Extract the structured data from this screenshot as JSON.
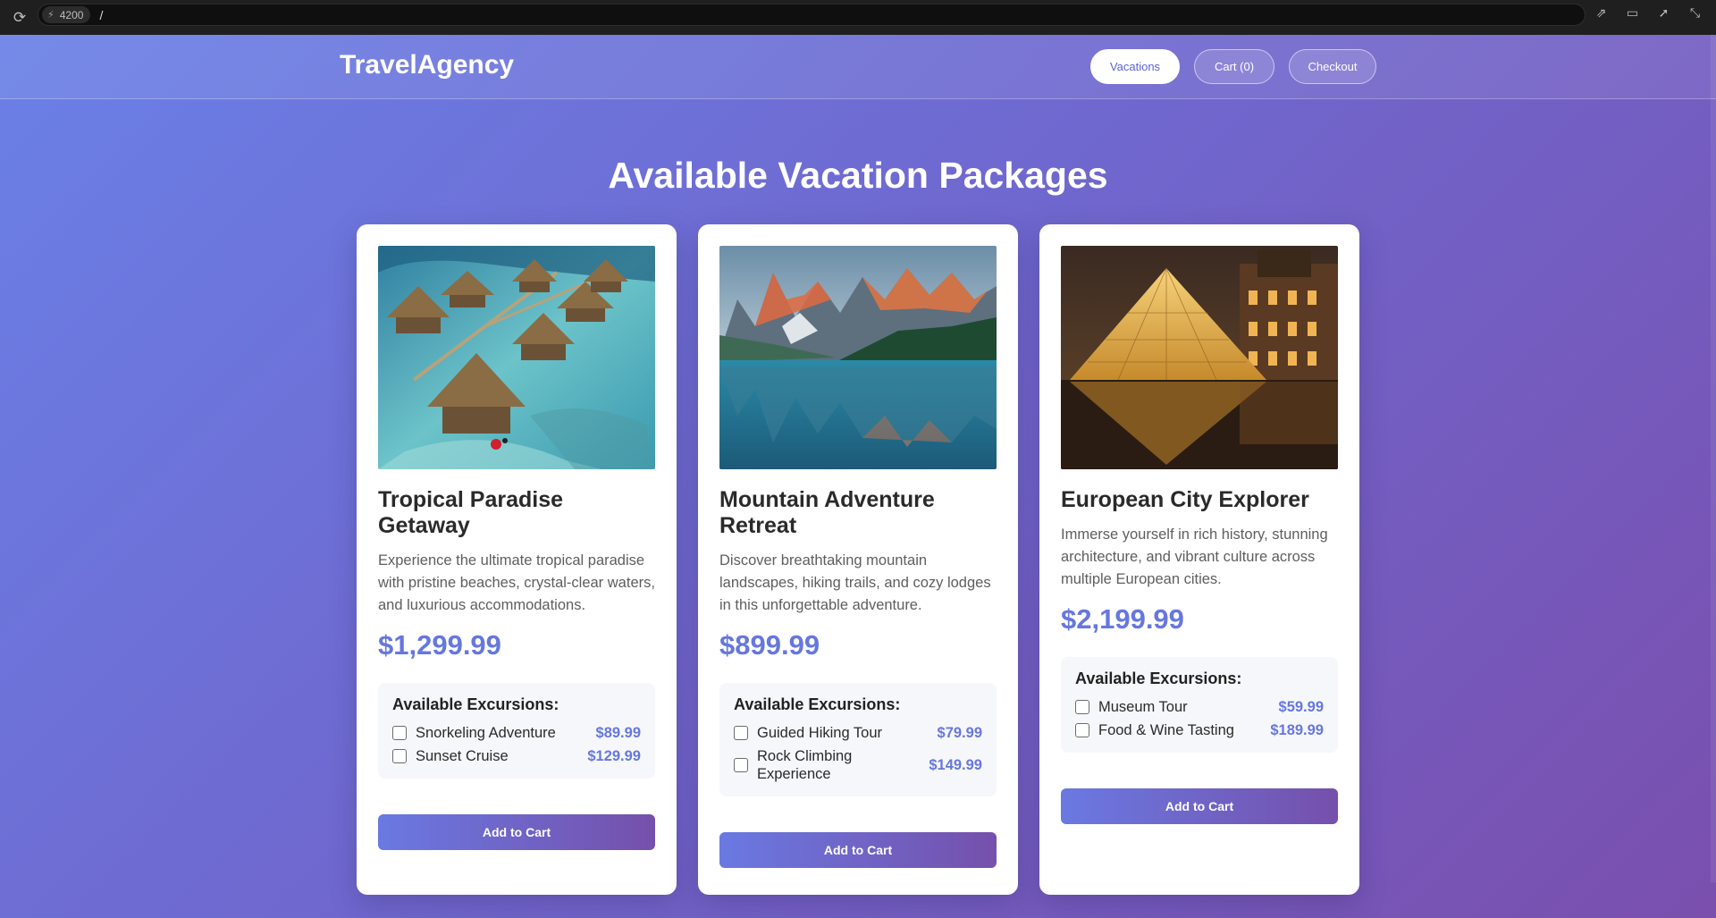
{
  "browser": {
    "port": "4200",
    "path": "/"
  },
  "nav": {
    "brand": "TravelAgency",
    "vacations_label": "Vacations",
    "cart_label": "Cart (0)",
    "checkout_label": "Checkout"
  },
  "heading": "Available Vacation Packages",
  "packages": [
    {
      "title": "Tropical Paradise Getaway",
      "description": "Experience the ultimate tropical paradise with pristine beaches, crystal-clear waters, and luxurious accommodations.",
      "price": "$1,299.99",
      "excursions_title": "Available Excursions:",
      "excursions": [
        {
          "name": "Snorkeling Adventure",
          "price": "$89.99",
          "checked": false
        },
        {
          "name": "Sunset Cruise",
          "price": "$129.99",
          "checked": false
        }
      ],
      "button_label": "Add to Cart"
    },
    {
      "title": "Mountain Adventure Retreat",
      "description": "Discover breathtaking mountain landscapes, hiking trails, and cozy lodges in this unforgettable adventure.",
      "price": "$899.99",
      "excursions_title": "Available Excursions:",
      "excursions": [
        {
          "name": "Guided Hiking Tour",
          "price": "$79.99",
          "checked": false
        },
        {
          "name": "Rock Climbing Experience",
          "price": "$149.99",
          "checked": false
        }
      ],
      "button_label": "Add to Cart"
    },
    {
      "title": "European City Explorer",
      "description": "Immerse yourself in rich history, stunning architecture, and vibrant culture across multiple European cities.",
      "price": "$2,199.99",
      "excursions_title": "Available Excursions:",
      "excursions": [
        {
          "name": "Museum Tour",
          "price": "$59.99",
          "checked": false
        },
        {
          "name": "Food & Wine Tasting",
          "price": "$189.99",
          "checked": false
        }
      ],
      "button_label": "Add to Cart"
    }
  ],
  "colors": {
    "accent": "#6677dd",
    "gradient_start": "#6a80e6",
    "gradient_end": "#7a4fae"
  }
}
